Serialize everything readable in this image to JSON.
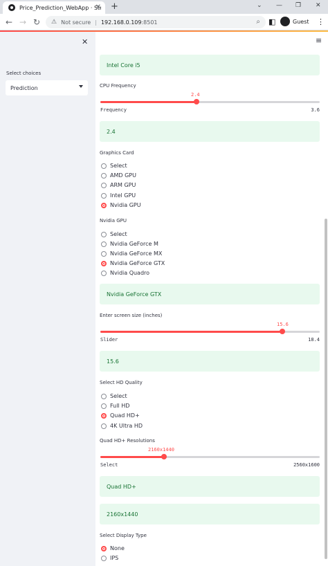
{
  "browser": {
    "tab_title": "Price_Prediction_WebApp · Strea",
    "not_secure": "Not secure",
    "url_host": "192.168.0.109",
    "url_port": ":8501",
    "profile_name": "Guest"
  },
  "sidebar": {
    "select_label": "Select choices",
    "select_value": "Prediction"
  },
  "main": {
    "processor_info": "Intel Core i5",
    "cpu_frequency": {
      "label": "CPU Frequency",
      "value_label": "2.4",
      "min_label": "Frequency",
      "max_label": "3.6",
      "fraction": 0.44
    },
    "cpu_frequency_info": "2.4",
    "graphics_card": {
      "label": "Graphics Card",
      "options": [
        "Select",
        "AMD GPU",
        "ARM GPU",
        "Intel GPU",
        "Nvidia GPU"
      ],
      "selected": "Nvidia GPU"
    },
    "nvidia_gpu": {
      "label": "Nvidia GPU",
      "options": [
        "Select",
        "Nvidia GeForce M",
        "Nvidia GeForce MX",
        "Nvidia GeForce GTX",
        "Nvidia Quadro"
      ],
      "selected": "Nvidia GeForce GTX"
    },
    "gpu_info": "Nvidia GeForce GTX",
    "screen_size": {
      "label": "Enter screen size (inches)",
      "value_label": "15.6",
      "min_label": "Slider",
      "max_label": "18.4",
      "fraction": 0.83
    },
    "screen_size_info": "15.6",
    "hd_quality": {
      "label": "Select HD Quality",
      "options": [
        "Select",
        "Full HD",
        "Quad HD+",
        "4K Ultra HD"
      ],
      "selected": "Quad HD+"
    },
    "resolution": {
      "label": "Quad HD+ Resolutions",
      "value_label": "2160x1440",
      "min_label": "Select",
      "max_label": "2560x1600",
      "fraction": 0.29
    },
    "hd_info": "Quad HD+",
    "resolution_info": "2160x1440",
    "display_type": {
      "label": "Select Display Type",
      "options": [
        "None",
        "IPS"
      ],
      "selected": "None"
    }
  },
  "colors": {
    "accent": "#ff4b4b",
    "info_bg": "#e8f9ee",
    "info_text": "#177233",
    "sidebar_bg": "#f0f2f6"
  }
}
